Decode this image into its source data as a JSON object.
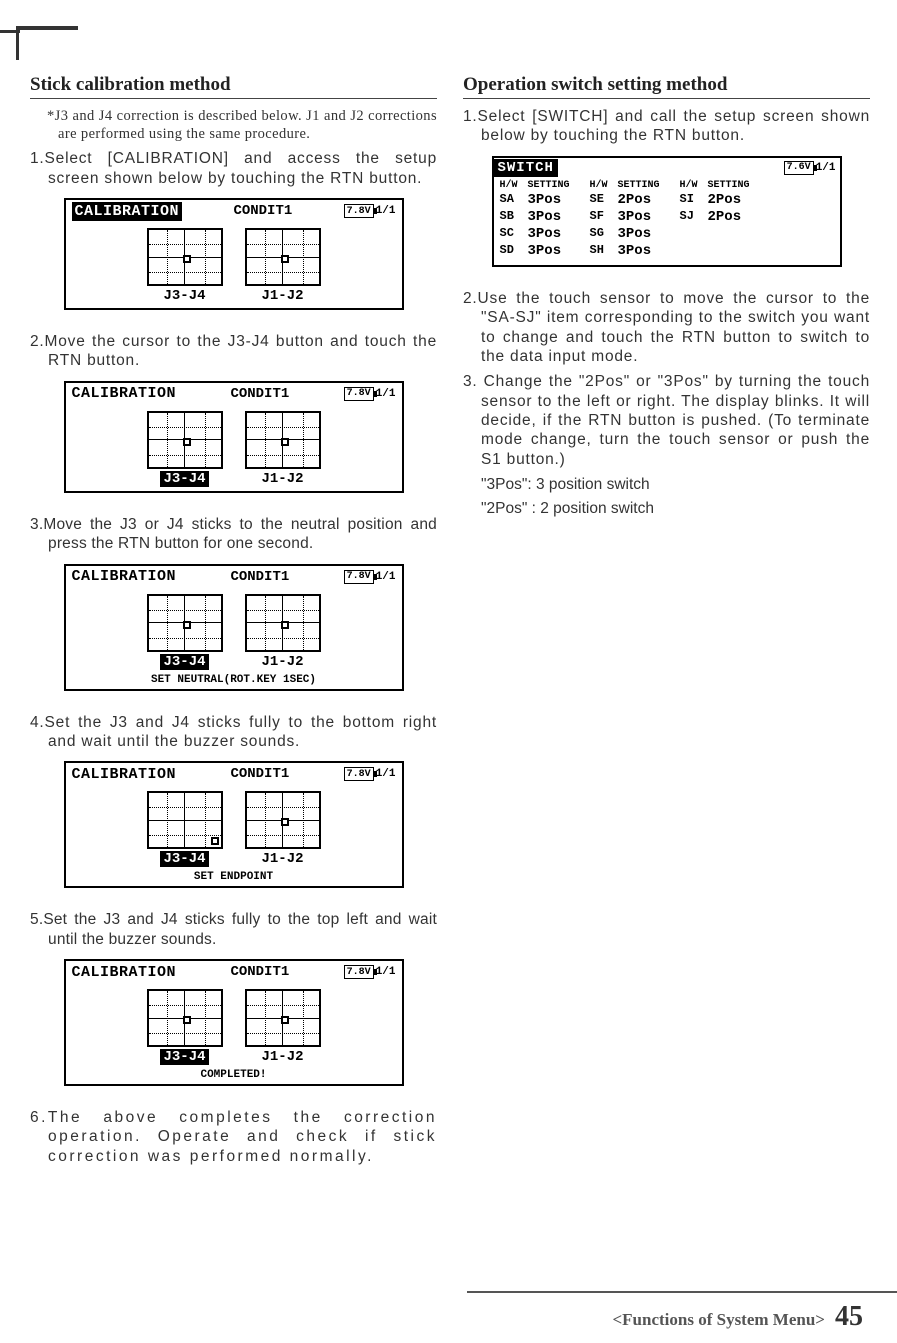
{
  "left": {
    "title": "Stick calibration method",
    "footnote": "*J3 and J4 correction is described below. J1 and J2 corrections are performed using the same procedure.",
    "steps": [
      "1.Select [CALIBRATION] and access the setup screen shown below by touching the RTN button.",
      "2.Move the cursor to the J3-J4 button and touch the RTN button.",
      "3.Move the J3 or J4 sticks to the neutral position and press the RTN button for one second.",
      "4.Set the J3 and J4 sticks fully to the bottom right and wait until the buzzer sounds.",
      "5.Set the J3 and J4 sticks fully to the top left and wait until the buzzer sounds.",
      "6.The above completes the correction operation. Operate and check if stick correction was performed normally."
    ],
    "lcd": {
      "title": "CALIBRATION",
      "mode": "CONDIT1",
      "batt": "7.8V",
      "page": "1/1",
      "left_label": "J3-J4",
      "right_label": "J1-J2",
      "footer3": "SET NEUTRAL(ROT.KEY 1SEC)",
      "footer4": "SET ENDPOINT",
      "footer5": "COMPLETED!"
    }
  },
  "right": {
    "title": "Operation switch setting method",
    "steps": [
      "1.Select [SWITCH] and call the setup screen shown below by touching the RTN button.",
      "2.Use the touch sensor to move the cursor to the \"SA-SJ\" item corresponding to the switch you want to change and touch the RTN button to switch to the data input mode.",
      "3. Change the \"2Pos\" or \"3Pos\" by turning the touch sensor to the left or right. The display blinks. It will decide, if the RTN button is pushed. (To terminate mode change, turn the touch sensor or push the S1 button.)"
    ],
    "notes": [
      "\"3Pos\": 3 position switch",
      "\"2Pos\" : 2 position switch"
    ],
    "switch_lcd": {
      "title": "SWITCH",
      "batt": "7.6V",
      "page": "1/1",
      "hw": "H/W",
      "setting": "SETTING",
      "rows": [
        [
          "SA",
          "3Pos",
          "SE",
          "2Pos",
          "SI",
          "2Pos"
        ],
        [
          "SB",
          "3Pos",
          "SF",
          "3Pos",
          "SJ",
          "2Pos"
        ],
        [
          "SC",
          "3Pos",
          "SG",
          "3Pos",
          "",
          ""
        ],
        [
          "SD",
          "3Pos",
          "SH",
          "3Pos",
          "",
          ""
        ]
      ]
    }
  },
  "footer": {
    "text": "<Functions of System Menu>",
    "page": "45"
  }
}
